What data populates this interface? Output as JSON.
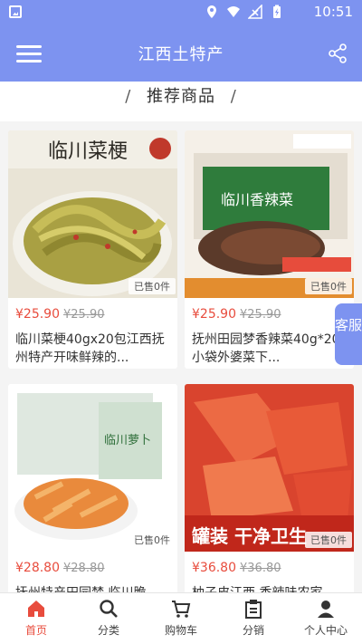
{
  "status": {
    "time": "10:51"
  },
  "header": {
    "title": "江西土特产"
  },
  "section": {
    "title": "推荐商品",
    "slash": "/"
  },
  "products": [
    {
      "price": "¥25.90",
      "old_price": "¥25.90",
      "sold": "已售0件",
      "title": "临川菜梗40gx20包江西抚州特产开味鲜辣的...",
      "img_text": "临川菜梗"
    },
    {
      "price": "¥25.90",
      "old_price": "¥25.90",
      "sold": "已售0件",
      "title": "抚州田园梦香辣菜40g*20小袋外婆菜下...",
      "img_text": "临川香辣菜"
    },
    {
      "price": "¥28.80",
      "old_price": "¥28.80",
      "sold": "已售0件",
      "title": "抚州特产田园梦 临川脆...",
      "img_text": "临川萝卜"
    },
    {
      "price": "¥36.80",
      "old_price": "¥36.80",
      "sold": "已售0件",
      "title": "柚子皮江西 香辣味农家...",
      "img_text": "罐装 干净卫生"
    }
  ],
  "kefu": {
    "label": "客服"
  },
  "tabbar": [
    {
      "label": "首页",
      "icon": "home-icon",
      "active": true
    },
    {
      "label": "分类",
      "icon": "search-icon",
      "active": false
    },
    {
      "label": "购物车",
      "icon": "cart-icon",
      "active": false
    },
    {
      "label": "分销",
      "icon": "document-icon",
      "active": false
    },
    {
      "label": "个人中心",
      "icon": "user-icon",
      "active": false
    }
  ],
  "colors": {
    "brand": "#7d93f0",
    "price": "#e84c3d",
    "active_tab": "#e84c3d"
  }
}
